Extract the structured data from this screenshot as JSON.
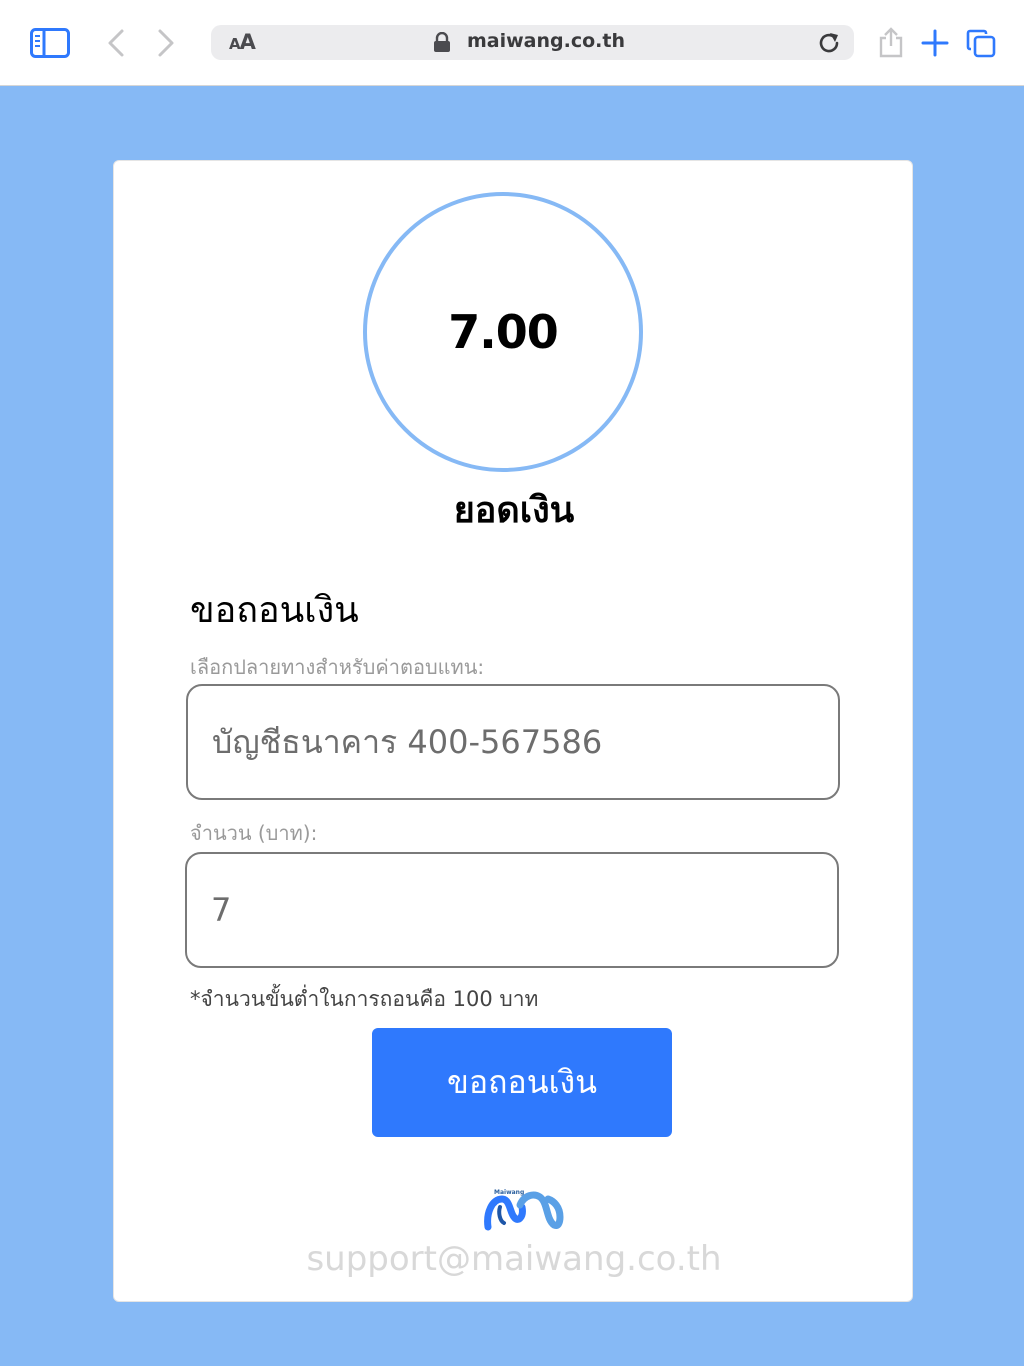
{
  "browser": {
    "text_size_label_small": "A",
    "text_size_label_large": "A",
    "url": "maiwang.co.th",
    "icons": [
      "sidebar-icon",
      "back-icon",
      "forward-icon",
      "lock-icon",
      "reload-icon",
      "share-icon",
      "plus-icon",
      "tabs-icon"
    ]
  },
  "balance": {
    "value": "7.00",
    "label": "ยอดเงิน",
    "ring_color": "#86b9f5"
  },
  "withdraw_form": {
    "title": "ขอถอนเงิน",
    "destination_label": "เลือกปลายทางสำหรับค่าตอบแทน:",
    "destination_value": "บัญชีธนาคาร 400-567586",
    "amount_label": "จำนวน (บาท):",
    "amount_value": "7",
    "min_note": "*จำนวนขั้นต่ำในการถอนคือ 100 บาท",
    "submit_label": "ขอถอนเงิน",
    "submit_color": "#2f79fd"
  },
  "footer": {
    "logo_text": "Maiwang",
    "support_email": "support@maiwang.co.th"
  },
  "colors": {
    "page_background": "#86b9f5",
    "card_background": "#ffffff",
    "accent": "#2f79fd"
  }
}
